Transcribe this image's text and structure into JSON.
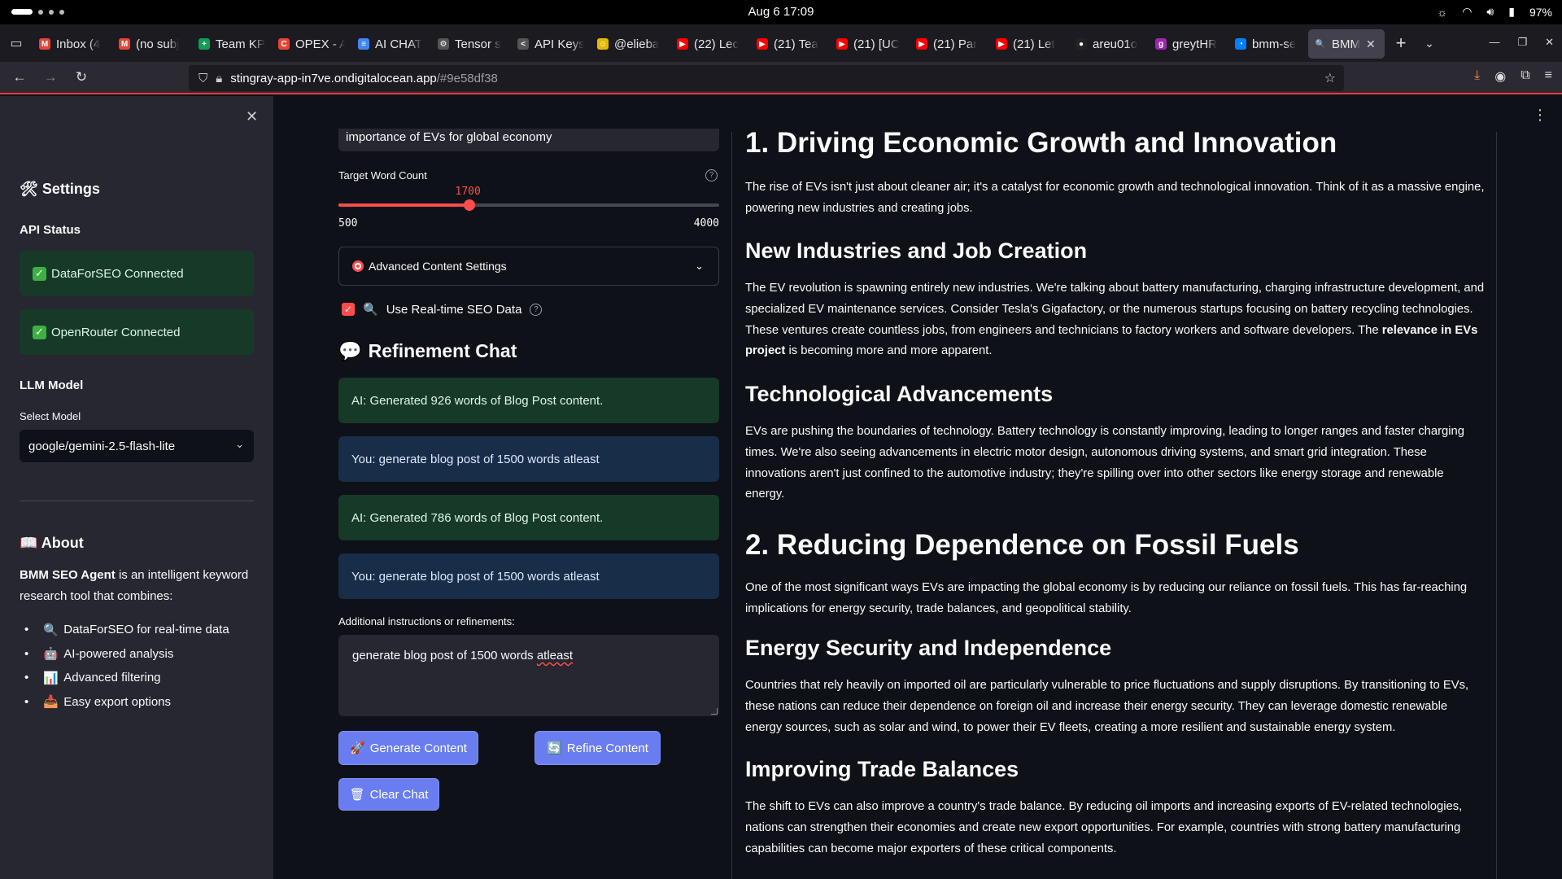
{
  "os": {
    "datetime": "Aug 6  17:09",
    "battery": "97%"
  },
  "tabs": [
    {
      "title": "Inbox (4",
      "icon": "gmail-icon",
      "color": "#ea4335",
      "glyph": "M"
    },
    {
      "title": "(no subj",
      "icon": "gmail-icon",
      "color": "#ea4335",
      "glyph": "M"
    },
    {
      "title": "Team KP",
      "icon": "sheets-icon",
      "color": "#0f9d58",
      "glyph": "+"
    },
    {
      "title": "OPEX - A",
      "icon": "slides-icon",
      "color": "#ea4335",
      "glyph": "C"
    },
    {
      "title": "AI CHAT",
      "icon": "docs-icon",
      "color": "#4285f4",
      "glyph": "≡"
    },
    {
      "title": "Tensor s",
      "icon": "gear-icon",
      "color": "#555",
      "glyph": "⚙"
    },
    {
      "title": "API Keys",
      "icon": "api-icon",
      "color": "#555",
      "glyph": "<"
    },
    {
      "title": "@elieba",
      "icon": "avatar-icon",
      "color": "#e6b800",
      "glyph": "☺"
    },
    {
      "title": "(22) Lec",
      "icon": "youtube-icon",
      "color": "#ff0000",
      "glyph": "▶"
    },
    {
      "title": "(21) Tea",
      "icon": "youtube-icon",
      "color": "#ff0000",
      "glyph": "▶"
    },
    {
      "title": "(21) [UC",
      "icon": "youtube-icon",
      "color": "#ff0000",
      "glyph": "▶"
    },
    {
      "title": "(21) Par",
      "icon": "youtube-icon",
      "color": "#ff0000",
      "glyph": "▶"
    },
    {
      "title": "(21) Let",
      "icon": "youtube-icon",
      "color": "#ff0000",
      "glyph": "▶"
    },
    {
      "title": "areu01o",
      "icon": "github-icon",
      "color": "#222",
      "glyph": "●"
    },
    {
      "title": "greytHR",
      "icon": "greythr-icon",
      "color": "#9c27b0",
      "glyph": "g"
    },
    {
      "title": "bmm-se",
      "icon": "digitalocean-icon",
      "color": "#0080ff",
      "glyph": "◔"
    },
    {
      "title": "BMM",
      "icon": "search-icon",
      "color": "#42414d",
      "glyph": "🔍",
      "active": true
    }
  ],
  "address": {
    "domain": "stingray-app-in7ve.ondigitalocean.app",
    "hash": "/#9e58df38"
  },
  "sidebar": {
    "title": "Settings",
    "api_status_heading": "API Status",
    "status1": "DataForSEO Connected",
    "status2": "OpenRouter Connected",
    "llm_heading": "LLM Model",
    "select_label": "Select Model",
    "selected_model": "google/gemini-2.5-flash-lite",
    "about_heading": "About",
    "about_brand": "BMM SEO Agent",
    "about_rest": " is an intelligent keyword research tool that combines:",
    "about_items": [
      {
        "emoji": "🔍",
        "text": "DataForSEO for real-time data"
      },
      {
        "emoji": "🤖",
        "text": "AI-powered analysis"
      },
      {
        "emoji": "📊",
        "text": "Advanced filtering"
      },
      {
        "emoji": "📥",
        "text": "Easy export options"
      }
    ]
  },
  "form": {
    "topic_value": "importance of EVs for global economy",
    "word_count_label": "Target Word Count",
    "word_count_value": "1700",
    "word_count_min": "500",
    "word_count_max": "4000",
    "word_count_fraction": 0.343,
    "advanced_label": "Advanced Content Settings",
    "realtime_label": "Use Real-time SEO Data",
    "realtime_checked": true
  },
  "chat": {
    "heading": "Refinement Chat",
    "messages": [
      {
        "role": "ai",
        "text": "AI: Generated 926 words of Blog Post content."
      },
      {
        "role": "you",
        "text": "You: generate blog post of 1500 words atleast"
      },
      {
        "role": "ai",
        "text": "AI: Generated 786 words of Blog Post content."
      },
      {
        "role": "you",
        "text": "You: generate blog post of 1500 words atleast"
      }
    ],
    "instructions_label": "Additional instructions or refinements:",
    "instructions_value_a": "generate blog post of 1500 words ",
    "instructions_value_b": "atleast",
    "generate_label": "Generate Content",
    "refine_label": "Refine Content",
    "clear_label": "Clear Chat"
  },
  "article": {
    "h1a": "1. Driving Economic Growth and Innovation",
    "p1": "The rise of EVs isn't just about cleaner air; it's a catalyst for economic growth and technological innovation. Think of it as a massive engine, powering new industries and creating jobs.",
    "h2a": "New Industries and Job Creation",
    "p2a": "The EV revolution is spawning entirely new industries. We're talking about battery manufacturing, charging infrastructure development, and specialized EV maintenance services. Consider Tesla's Gigafactory, or the numerous startups focusing on battery recycling technologies. These ventures create countless jobs, from engineers and technicians to factory workers and software developers. The ",
    "p2bold": "relevance in EVs project",
    "p2b": " is becoming more and more apparent.",
    "h2b": "Technological Advancements",
    "p3": "EVs are pushing the boundaries of technology. Battery technology is constantly improving, leading to longer ranges and faster charging times. We're also seeing advancements in electric motor design, autonomous driving systems, and smart grid integration. These innovations aren't just confined to the automotive industry; they're spilling over into other sectors like energy storage and renewable energy.",
    "h1b": "2. Reducing Dependence on Fossil Fuels",
    "p4": "One of the most significant ways EVs are impacting the global economy is by reducing our reliance on fossil fuels. This has far-reaching implications for energy security, trade balances, and geopolitical stability.",
    "h2c": "Energy Security and Independence",
    "p5": "Countries that rely heavily on imported oil are particularly vulnerable to price fluctuations and supply disruptions. By transitioning to EVs, these nations can reduce their dependence on foreign oil and increase their energy security. They can leverage domestic renewable energy sources, such as solar and wind, to power their EV fleets, creating a more resilient and sustainable energy system.",
    "h2d": "Improving Trade Balances",
    "p6": "The shift to EVs can also improve a country's trade balance. By reducing oil imports and increasing exports of EV-related technologies, nations can strengthen their economies and create new export opportunities. For example, countries with strong battery manufacturing capabilities can become major exporters of these critical components."
  }
}
